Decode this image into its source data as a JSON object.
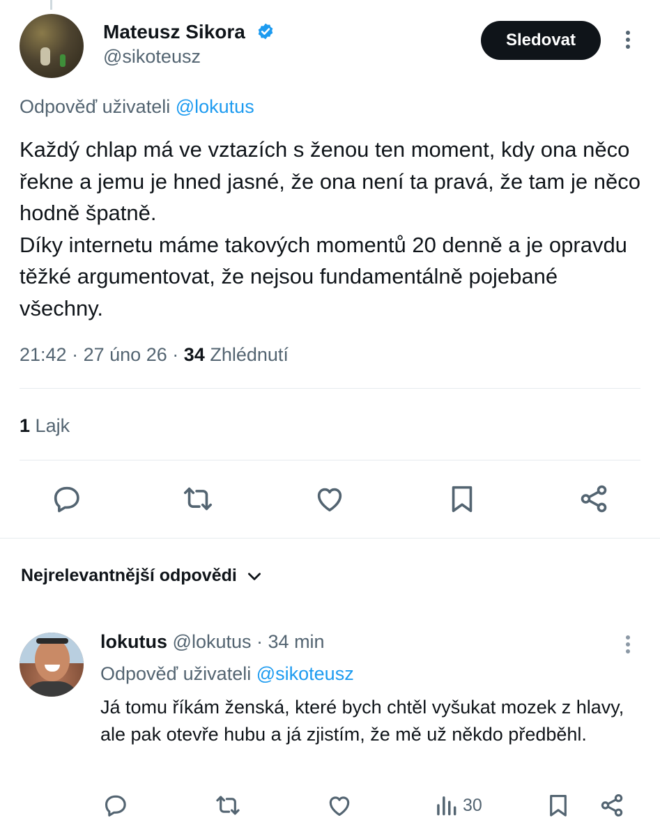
{
  "tweet": {
    "author": {
      "name": "Mateusz Sikora",
      "handle": "@sikoteusz",
      "verified": true
    },
    "follow_label": "Sledovat",
    "reply_prefix": "Odpověď uživateli",
    "reply_to": "@lokutus",
    "text_lines": [
      "Každý chlap má ve vztazích s ženou ten moment, kdy ona něco řekne a jemu je hned jasné, že ona není ta pravá, že tam je něco hodně špatně.",
      "Díky internetu máme takových momentů 20 denně a je opravdu těžké argumentovat, že nejsou fundamentálně pojebané všechny."
    ],
    "time": "21:42",
    "sep": "·",
    "date": "27 úno 26",
    "views_count": "34",
    "views_label": "Zhlédnutí",
    "likes_count": "1",
    "likes_label": "Lajk",
    "actions": [
      "reply-icon",
      "retweet-icon",
      "like-icon",
      "bookmark-icon",
      "share-icon"
    ]
  },
  "replies_section": {
    "sort_label": "Nejrelevantnější odpovědi"
  },
  "reply": {
    "name": "lokutus",
    "handle": "@lokutus",
    "sep": "·",
    "time": "34 min",
    "reply_prefix": "Odpověď uživateli",
    "reply_to": "@sikoteusz",
    "text": "Já tomu říkám ženská, které bych chtěl vyšukat mozek z hlavy, ale pak otevře hubu a já zjistím, že mě už někdo předběhl.",
    "views": "30"
  },
  "colors": {
    "text": "#0f1419",
    "secondary": "#536471",
    "link": "#1d9bf0",
    "verified": "#1d9bf0",
    "button_bg": "#0f1419",
    "divider": "#e6ebee"
  }
}
